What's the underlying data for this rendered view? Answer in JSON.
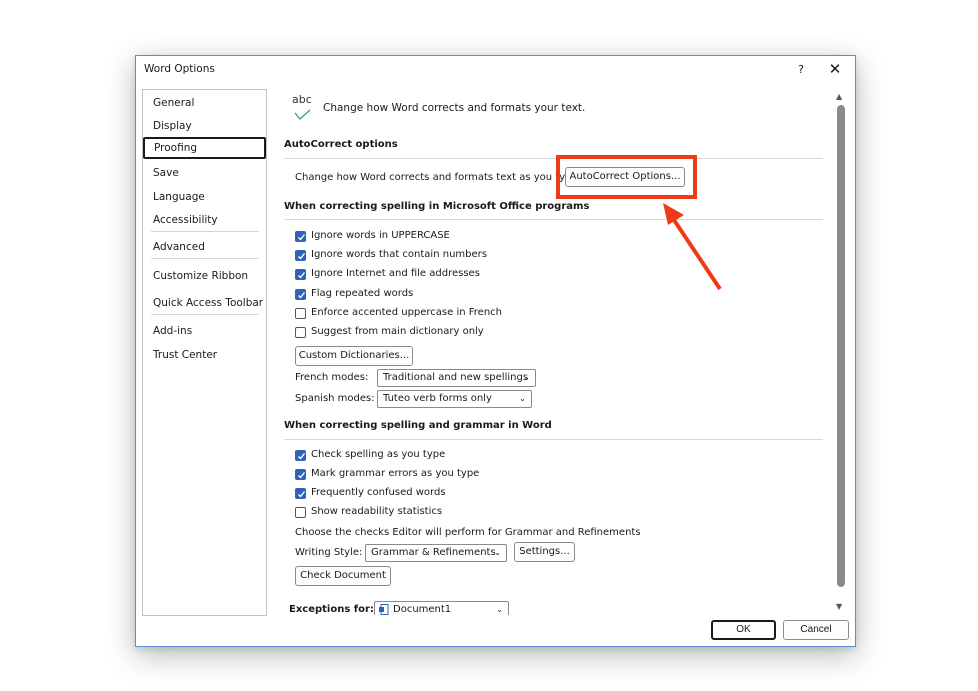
{
  "window": {
    "title": "Word Options",
    "help": "?",
    "close": "✕"
  },
  "nav": {
    "items": [
      {
        "label": "General"
      },
      {
        "label": "Display"
      },
      {
        "label": "Proofing"
      },
      {
        "label": "Save"
      },
      {
        "label": "Language"
      },
      {
        "label": "Accessibility"
      },
      {
        "label": "Advanced"
      },
      {
        "label": "Customize Ribbon"
      },
      {
        "label": "Quick Access Toolbar"
      },
      {
        "label": "Add-ins"
      },
      {
        "label": "Trust Center"
      }
    ],
    "selected": "Proofing"
  },
  "header": {
    "icon_text": "abc",
    "text": "Change how Word corrects and formats your text."
  },
  "autocorrect": {
    "title": "AutoCorrect options",
    "description": "Change how Word corrects and formats text as you type:",
    "button": "AutoCorrect Options..."
  },
  "office_spelling": {
    "title": "When correcting spelling in Microsoft Office programs",
    "options": [
      {
        "label": "Ignore words in UPPERCASE",
        "checked": true
      },
      {
        "label": "Ignore words that contain numbers",
        "checked": true
      },
      {
        "label": "Ignore Internet and file addresses",
        "checked": true
      },
      {
        "label": "Flag repeated words",
        "checked": true
      },
      {
        "label": "Enforce accented uppercase in French",
        "checked": false
      },
      {
        "label": "Suggest from main dictionary only",
        "checked": false
      }
    ],
    "custom_dictionaries": "Custom Dictionaries...",
    "french_modes_label": "French modes:",
    "french_modes_value": "Traditional and new spellings",
    "spanish_modes_label": "Spanish modes:",
    "spanish_modes_value": "Tuteo verb forms only"
  },
  "word_spelling": {
    "title": "When correcting spelling and grammar in Word",
    "options": [
      {
        "label": "Check spelling as you type",
        "checked": true
      },
      {
        "label": "Mark grammar errors as you type",
        "checked": true
      },
      {
        "label": "Frequently confused words",
        "checked": true
      },
      {
        "label": "Show readability statistics",
        "checked": false
      }
    ],
    "checks_text": "Choose the checks Editor will perform for Grammar and Refinements",
    "writing_style_label": "Writing Style:",
    "writing_style_value": "Grammar & Refinements",
    "settings_button": "Settings...",
    "check_document_button": "Check Document"
  },
  "exceptions": {
    "label": "Exceptions for:",
    "value": "Document1"
  },
  "footer": {
    "ok": "OK",
    "cancel": "Cancel"
  },
  "colors": {
    "accent": "#2f63b9",
    "highlight": "#f03a17"
  }
}
